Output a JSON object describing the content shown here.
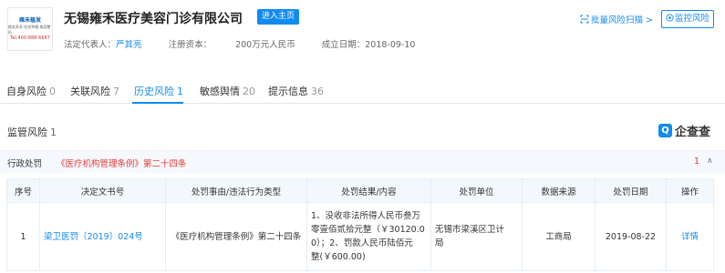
{
  "company": {
    "logo_title": "雍禾植发",
    "logo_sub": "植发养发·毛发种植·美容整形",
    "logo_phone": "Tel:400-888-6687",
    "name": "无锡雍禾医疗美容门诊有限公司",
    "enter_label": "进入主页",
    "legal_rep_label": "法定代表人：",
    "legal_rep": "严其亮",
    "capital_label": "注册资本：",
    "capital": "200万元人民币",
    "founded_label": "成立日期：",
    "founded": "2018-09-10"
  },
  "actions": {
    "scan_label": "批量风险扫描 >",
    "monitor_label": "监控风险"
  },
  "tabs": [
    {
      "label": "自身风险",
      "count": "0"
    },
    {
      "label": "关联风险",
      "count": "7"
    },
    {
      "label": "历史风险",
      "count": "1"
    },
    {
      "label": "敏感舆情",
      "count": "20"
    },
    {
      "label": "提示信息",
      "count": "36"
    }
  ],
  "section": {
    "title": "监管风险",
    "count": "1",
    "brand": "企查查",
    "brand_mark": "Q"
  },
  "subhead": {
    "label": "行政处罚",
    "reason": "《医疗机构管理条例》第二十四条",
    "count": "1",
    "chevron": "∧"
  },
  "table": {
    "headers": [
      "序号",
      "决定文书号",
      "处罚事由/违法行为类型",
      "处罚结果/内容",
      "处罚单位",
      "数据来源",
      "处罚日期",
      "操作"
    ],
    "rows": [
      {
        "no": "1",
        "doc": "梁卫医罚〔2019〕024号",
        "reason": "《医疗机构管理条例》第二十四条",
        "result_line1": "1、没收非法所得人民币叁万",
        "result_line2": "零壹佰贰拾元整（￥30120.0",
        "result_line3": "0）；2、罚款人民币陆佰元",
        "result_line4": "整(￥600.00)",
        "unit_line1": "无锡市梁溪区卫计",
        "unit_line2": "局",
        "source": "工商局",
        "date": "2019-08-22",
        "action": "详情"
      }
    ]
  }
}
